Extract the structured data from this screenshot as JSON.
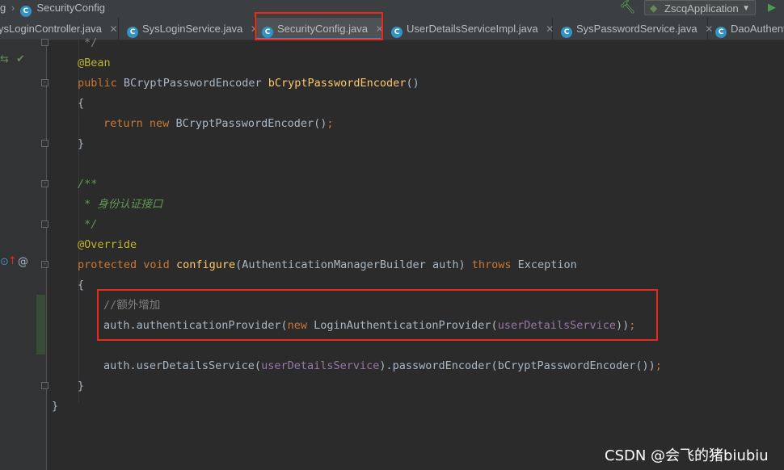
{
  "breadcrumb": {
    "parent": "g",
    "file": "SecurityConfig"
  },
  "toolbar": {
    "run_config_label": "ZscqApplication",
    "build_icon": "hammer-icon",
    "run_icon": "run-icon"
  },
  "tabs": [
    {
      "label": "ysLoginController.java",
      "active": false
    },
    {
      "label": "SysLoginService.java",
      "active": false
    },
    {
      "label": "SecurityConfig.java",
      "active": true
    },
    {
      "label": "UserDetailsServiceImpl.java",
      "active": false
    },
    {
      "label": "SysPasswordService.java",
      "active": false
    },
    {
      "label": "DaoAuthent",
      "active": false
    }
  ],
  "code": {
    "l01": "*/",
    "l02_ann": "@Bean",
    "l03_kw": "public",
    "l03_type": "BCryptPasswordEncoder",
    "l03_fn": "bCryptPasswordEncoder",
    "l03_parens": "()",
    "l04": "{",
    "l05_kw1": "return",
    "l05_kw2": "new",
    "l05_rest": "BCryptPasswordEncoder()",
    "l05_semi": ";",
    "l06": "}",
    "l08": "/**",
    "l09": " * 身份认证接口",
    "l10": " */",
    "l11_ann": "@Override",
    "l12_kw1": "protected",
    "l12_kw2": "void",
    "l12_fn": "configure",
    "l12_args": "(AuthenticationManagerBuilder auth)",
    "l12_kw3": "throws",
    "l12_exc": "Exception",
    "l13": "{",
    "l14": "//额外增加",
    "l15_a": "auth.authenticationProvider(",
    "l15_kw": "new",
    "l15_b": "LoginAuthenticationProvider(",
    "l15_field": "userDetailsService",
    "l15_c": "))",
    "l15_semi": ";",
    "l17_a": "auth.userDetailsService(",
    "l17_field": "userDetailsService",
    "l17_b": ").passwordEncoder(bCryptPasswordEncoder())",
    "l17_semi": ";",
    "l18": "}",
    "l19": "}"
  },
  "watermark": "CSDN @会飞的猪biubiu",
  "colors": {
    "editor_bg": "#2b2b2b",
    "keyword": "#cc7832",
    "annotation": "#bbb529",
    "method": "#ffc66d",
    "doc_comment": "#629755",
    "line_comment": "#808080",
    "field": "#9876aa",
    "highlight_box": "#e8291c"
  }
}
